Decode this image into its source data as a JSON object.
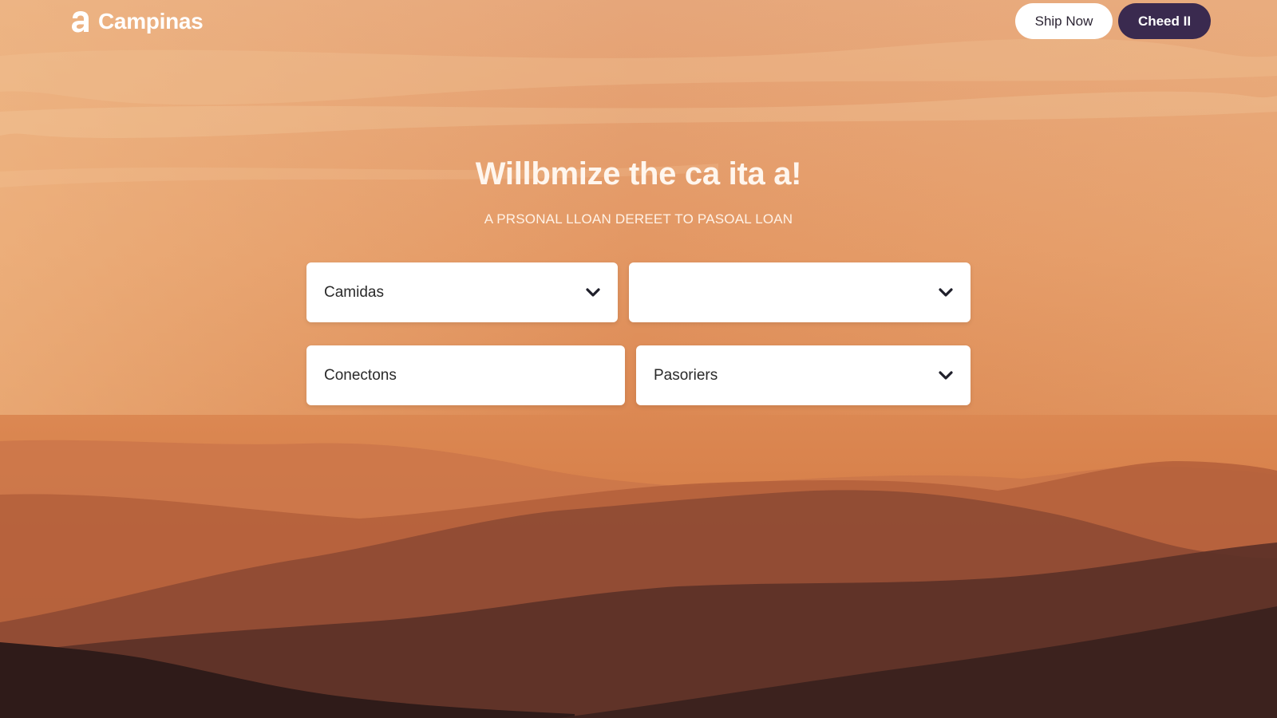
{
  "brand": {
    "name": "Campinas",
    "logo_icon": "campinas-logo-icon"
  },
  "nav": {
    "ship_now_label": "Ship Now",
    "check_label": "Cheed II"
  },
  "hero": {
    "title": "Willbmize the ca ita a!",
    "subtitle": "A PRSONAL LLOAN DEREET TO PASOAL LOAN"
  },
  "form": {
    "fields": [
      {
        "value": "Camidas",
        "type": "select",
        "icon": "chevron-down-icon"
      },
      {
        "value": "",
        "type": "select",
        "icon": "chevron-down-icon"
      },
      {
        "value": "Conectons",
        "type": "input"
      },
      {
        "value": "Pasoriers",
        "type": "select",
        "icon": "chevron-down-icon"
      }
    ]
  },
  "colors": {
    "sky_top": "#e8a873",
    "sky_bottom": "#d9834d",
    "button_dark": "#3a2a4f",
    "field_bg": "#ffffff"
  }
}
